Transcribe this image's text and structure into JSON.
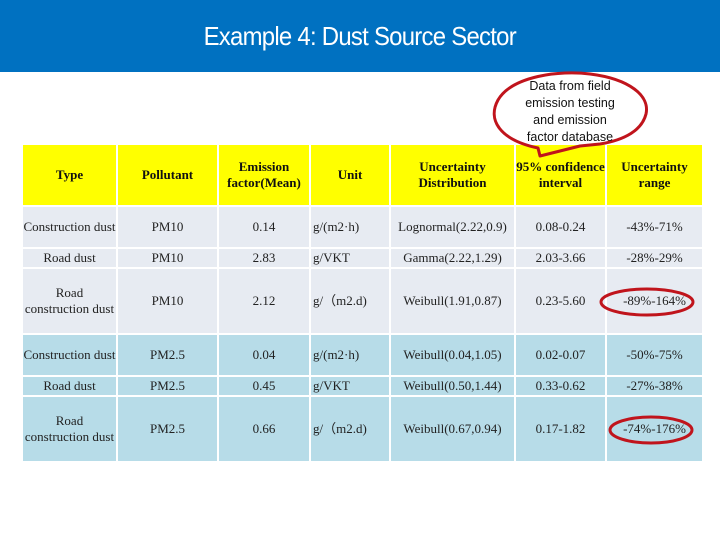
{
  "title": "Example 4:   Dust  Source Sector",
  "callout": {
    "lines": [
      "Data from field",
      "emission testing",
      "and  emission",
      "factor database"
    ],
    "outline_color": "#c0141c"
  },
  "colors": {
    "title_bar": "#0071c1",
    "header_bg": "#ffff00",
    "pm10_row_bg": "#e7ebf2",
    "pm25_row_bg": "#b7dce8",
    "highlight_ring": "#c0141c"
  },
  "table": {
    "headers": [
      "Type",
      "Pollutant",
      "Emission factor(Mean)",
      "Unit",
      "Uncertainty Distribution",
      "95% confidence interval",
      "Uncertainty range"
    ],
    "rows": [
      {
        "type": "Construction dust",
        "pollutant": "PM10",
        "ef": "0.14",
        "unit": "g/(m2·h)",
        "dist": "Lognormal(2.22,0.9)",
        "ci": "0.08-0.24",
        "range": "-43%-71%",
        "highlighted": false
      },
      {
        "type": "Road dust",
        "pollutant": "PM10",
        "ef": "2.83",
        "unit": "g/VKT",
        "dist": "Gamma(2.22,1.29)",
        "ci": "2.03-3.66",
        "range": "-28%-29%",
        "highlighted": false
      },
      {
        "type": "Road construction dust",
        "pollutant": "PM10",
        "ef": "2.12",
        "unit": "g/（m2.d)",
        "dist": "Weibull(1.91,0.87)",
        "ci": "0.23-5.60",
        "range": "-89%-164%",
        "highlighted": true
      },
      {
        "type": "Construction dust",
        "pollutant": "PM2.5",
        "ef": "0.04",
        "unit": "g/(m2·h)",
        "dist": "Weibull(0.04,1.05)",
        "ci": "0.02-0.07",
        "range": "-50%-75%",
        "highlighted": false
      },
      {
        "type": "Road dust",
        "pollutant": "PM2.5",
        "ef": "0.45",
        "unit": "g/VKT",
        "dist": "Weibull(0.50,1.44)",
        "ci": "0.33-0.62",
        "range": "-27%-38%",
        "highlighted": false
      },
      {
        "type": "Road construction dust",
        "pollutant": "PM2.5",
        "ef": "0.66",
        "unit": "g/（m2.d)",
        "dist": "Weibull(0.67,0.94)",
        "ci": "0.17-1.82",
        "range": "-74%-176%",
        "highlighted": true
      }
    ]
  }
}
